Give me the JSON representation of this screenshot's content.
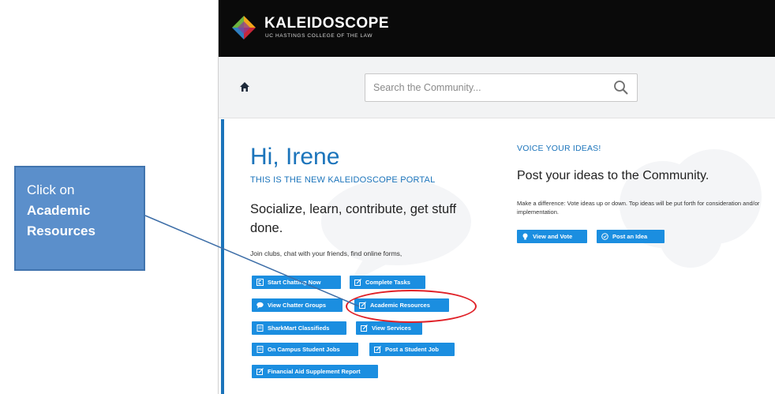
{
  "callout": {
    "line1": "Click on",
    "line2": "Academic",
    "line3": "Resources"
  },
  "header": {
    "brand": "KALEIDOSCOPE",
    "subtitle": "UC HASTINGS COLLEGE OF THE LAW"
  },
  "search": {
    "placeholder": "Search the Community..."
  },
  "welcome": {
    "greeting": "Hi, Irene",
    "subtitle": "THIS IS THE NEW KALEIDOSCOPE PORTAL",
    "tagline": "Socialize, learn, contribute, get stuff done.",
    "intro": "Join clubs, chat with your friends, find online forms,"
  },
  "buttons": {
    "start_chatting": "Start Chatting Now",
    "complete_tasks": "Complete Tasks",
    "view_chatter_groups": "View Chatter Groups",
    "academic_resources": "Academic Resources",
    "sharkmart": "SharkMart Classifieds",
    "view_services": "View Services",
    "campus_jobs": "On Campus Student Jobs",
    "post_job": "Post a Student Job",
    "financial_aid": "Financial Aid Supplement Report"
  },
  "ideas": {
    "heading": "VOICE YOUR IDEAS!",
    "title": "Post your ideas to the Community.",
    "description": "Make a difference: Vote ideas up or down. Top ideas will be put forth for consideration and/or implementation.",
    "view_vote": "View and Vote",
    "post_idea": "Post an Idea"
  },
  "colors": {
    "accent": "#1b74bb",
    "button": "#1b8ee0",
    "callout": "#5b8fcb",
    "highlight": "#e02027"
  }
}
